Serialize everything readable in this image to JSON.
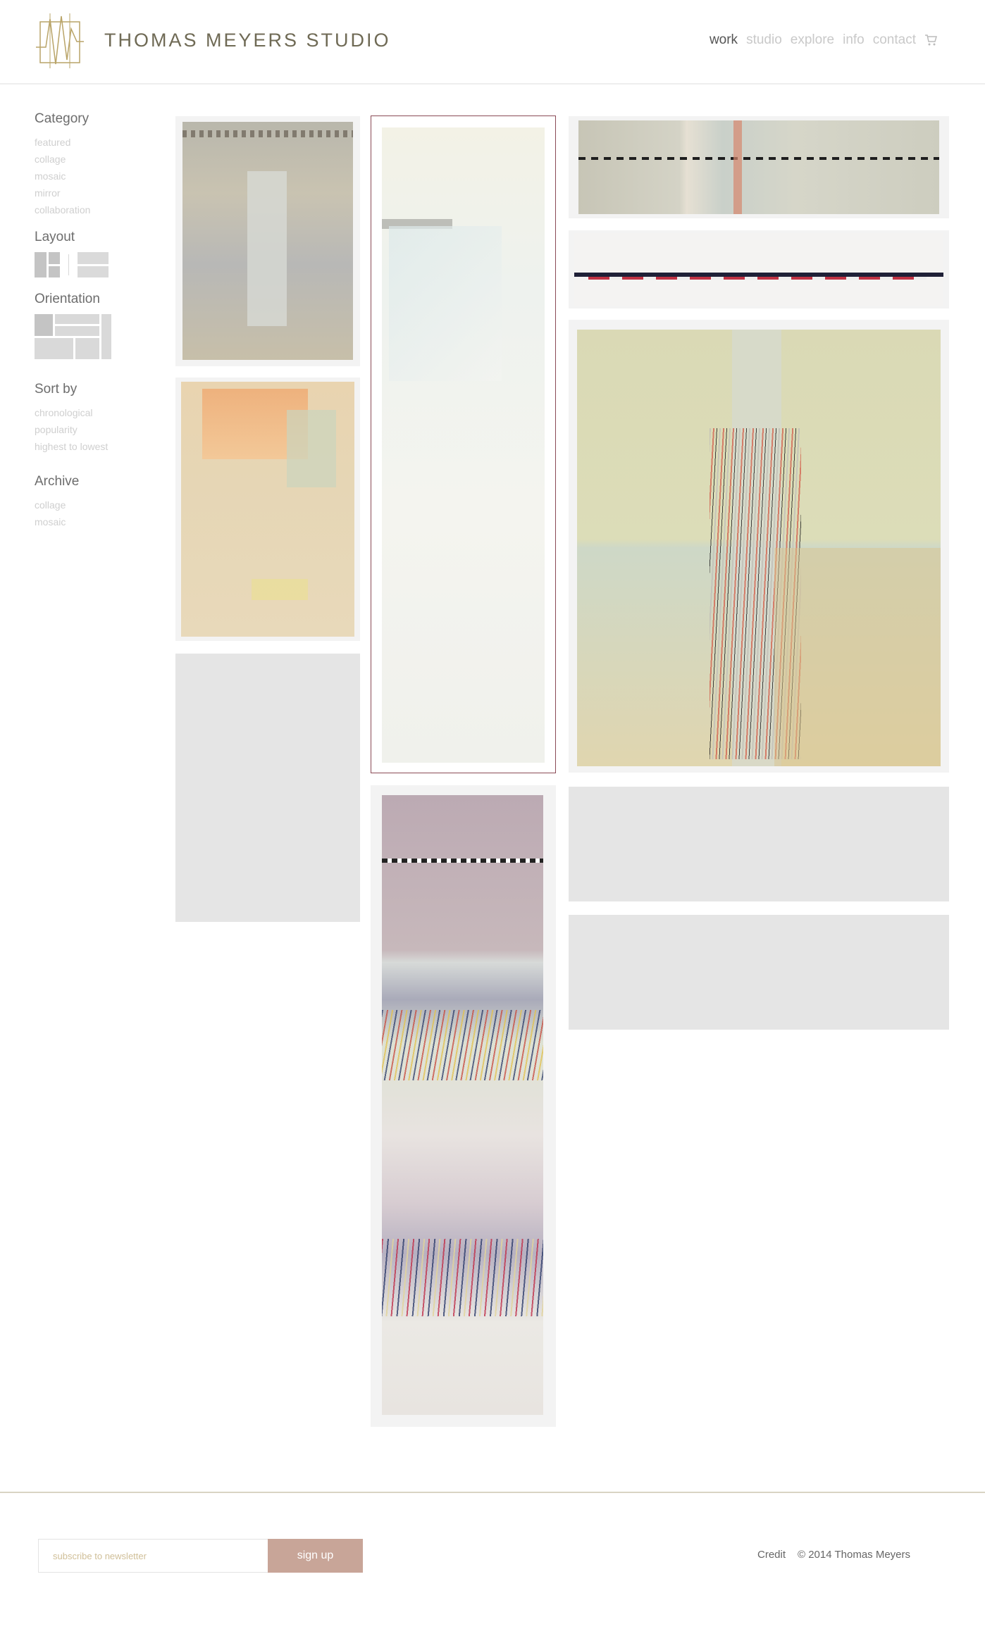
{
  "brand": {
    "name": "THOMAS MEYERS STUDIO"
  },
  "nav": {
    "items": [
      {
        "label": "work",
        "active": true
      },
      {
        "label": "studio"
      },
      {
        "label": "explore"
      },
      {
        "label": "info"
      },
      {
        "label": "contact"
      }
    ],
    "cart_icon": "cart-icon"
  },
  "sidebar": {
    "category": {
      "heading": "Category",
      "items": [
        "featured",
        "collage",
        "mosaic",
        "mirror",
        "collaboration"
      ]
    },
    "layout": {
      "heading": "Layout"
    },
    "orientation": {
      "heading": "Orientation"
    },
    "sort": {
      "heading": "Sort by",
      "items": [
        "chronological",
        "popularity",
        "highest to lowest"
      ]
    },
    "archive": {
      "heading": "Archive",
      "items": [
        "collage",
        "mosaic"
      ]
    }
  },
  "footer": {
    "newsletter_placeholder": "subscribe to newsletter",
    "signup_label": "sign up",
    "credit": "Credit",
    "copyright": "© 2014 Thomas Meyers"
  },
  "colors": {
    "accent": "#c8a598",
    "brand": "#6f6a55",
    "selected_border": "#8a4a55",
    "placeholder_tile": "#e5e5e5"
  }
}
